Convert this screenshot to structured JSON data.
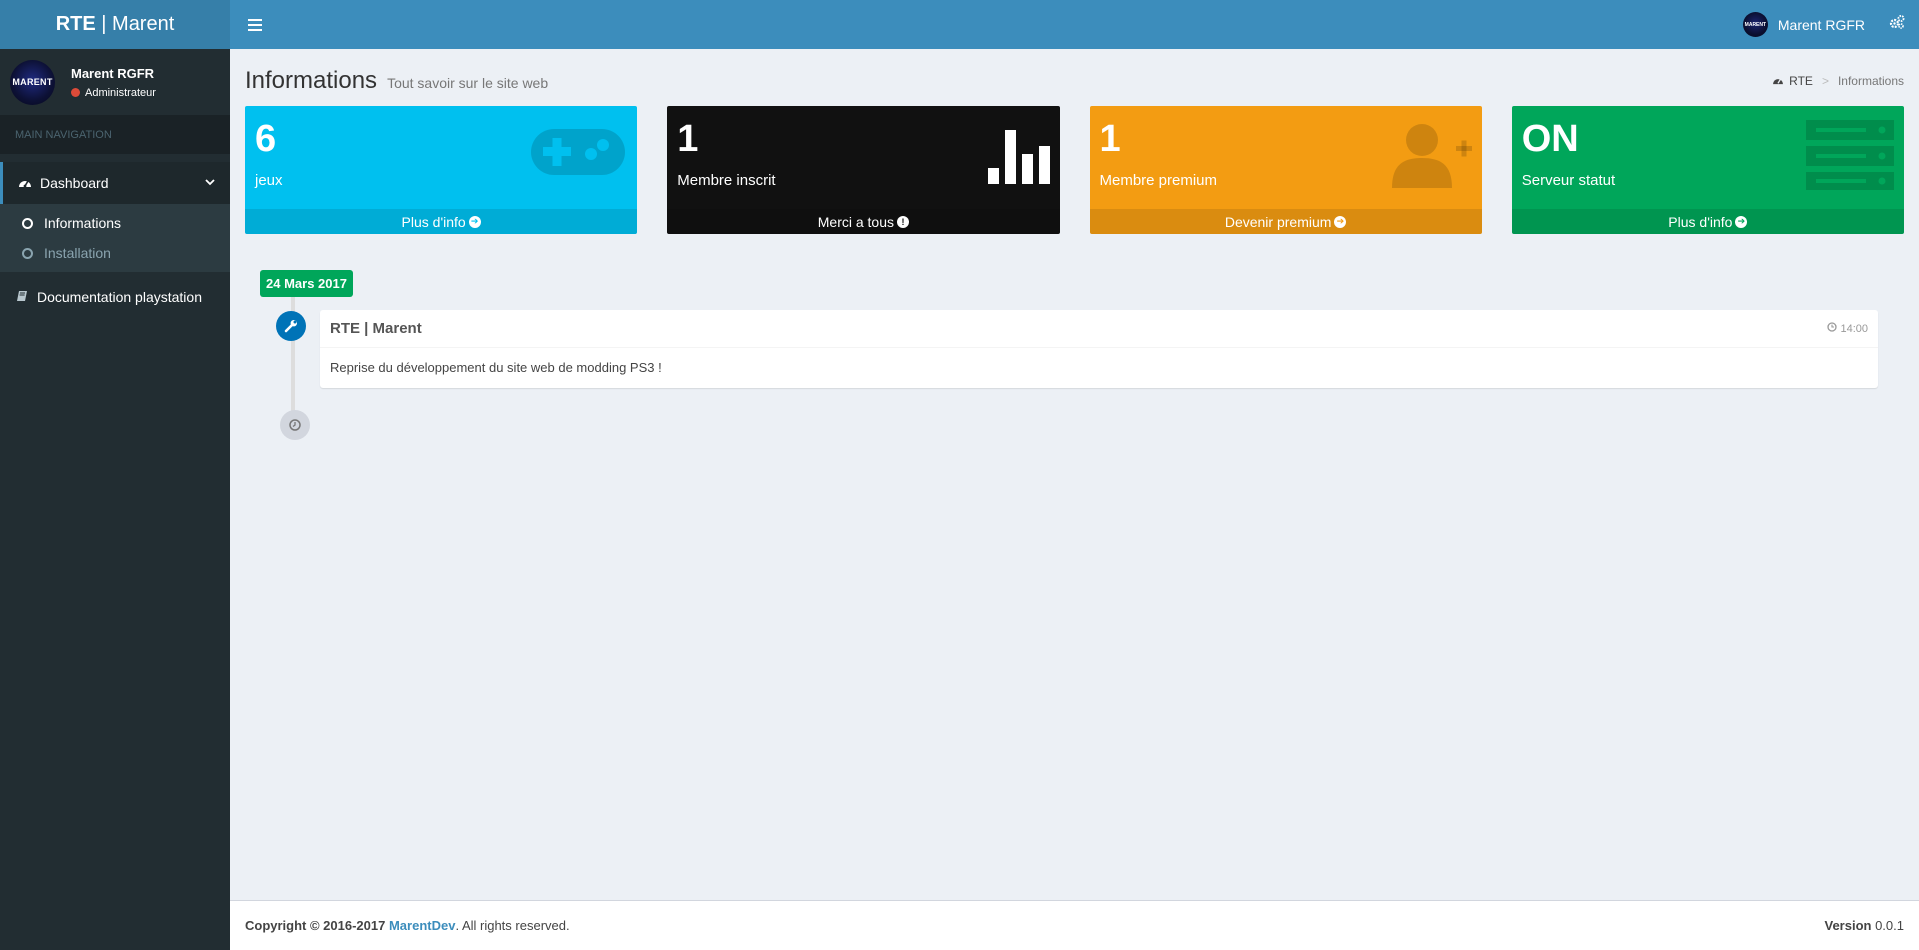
{
  "app": {
    "logo_bold": "RTE",
    "logo_rest": " | Marent",
    "colors": {
      "header": "#3c8dbc",
      "logo_bg": "#367fa9",
      "sidebar": "#222d32",
      "aqua": "#00c0ef",
      "black": "#111111",
      "orange": "#f39c12",
      "green": "#00a65a",
      "timeline_icon": "#0073b7"
    }
  },
  "header": {
    "user_name": "Marent RGFR",
    "avatar_text": "MARENT",
    "menu_icon": "hamburger-icon",
    "settings_icon": "gears-icon"
  },
  "sidebar": {
    "avatar_text": "MARENT",
    "user_name": "Marent RGFR",
    "user_role": "Administrateur",
    "nav_header": "MAIN NAVIGATION",
    "dashboard_label": "Dashboard",
    "sub_items": [
      {
        "label": "Informations",
        "active": true
      },
      {
        "label": "Installation",
        "active": false
      }
    ],
    "doc_label": "Documentation playstation"
  },
  "content": {
    "title": "Informations",
    "subtitle": "Tout savoir sur le site web",
    "breadcrumb": {
      "root": "RTE",
      "current": "Informations"
    }
  },
  "boxes": [
    {
      "value": "6",
      "label": "jeux",
      "footer": "Plus d'info",
      "icon": "gamepad-icon",
      "color": "aqua"
    },
    {
      "value": "1",
      "label": "Membre inscrit",
      "footer": "Merci a tous",
      "icon": "bar-chart-icon",
      "color": "black"
    },
    {
      "value": "1",
      "label": "Membre premium",
      "footer": "Devenir premium",
      "icon": "user-plus-icon",
      "color": "orange"
    },
    {
      "value": "ON",
      "label": "Serveur statut",
      "footer": "Plus d'info",
      "icon": "server-icon",
      "color": "green"
    }
  ],
  "timeline": {
    "date_label": "24 Mars 2017",
    "item_title": "RTE | Marent",
    "item_time": "14:00",
    "item_body": "Reprise du développement du site web de modding PS3 !"
  },
  "footer": {
    "copyright_prefix": "Copyright © 2016-2017 ",
    "brand": "MarentDev",
    "copyright_suffix": ". All rights reserved.",
    "version_label": "Version",
    "version": "0.0.1"
  }
}
